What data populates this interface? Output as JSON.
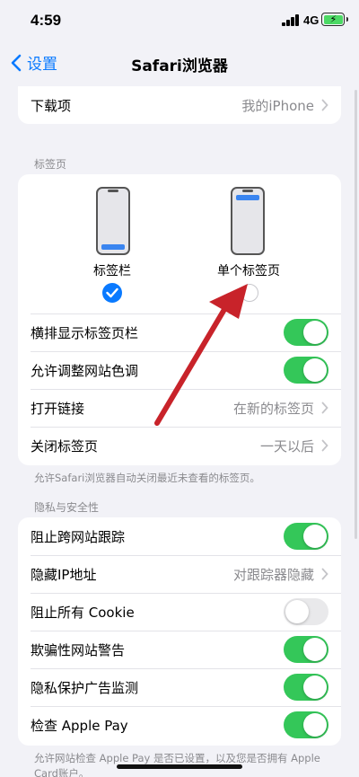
{
  "status_bar": {
    "time": "4:59",
    "network": "4G"
  },
  "nav": {
    "back_label": "设置",
    "title": "Safari浏览器"
  },
  "downloads": {
    "label": "下载项",
    "value": "我的iPhone"
  },
  "tabs_section": {
    "header": "标签页",
    "layout_options": [
      {
        "label": "标签栏",
        "selected": true
      },
      {
        "label": "单个标签页",
        "selected": false
      }
    ],
    "rows": [
      {
        "label": "横排显示标签页栏",
        "type": "toggle",
        "on": true
      },
      {
        "label": "允许调整网站色调",
        "type": "toggle",
        "on": true
      },
      {
        "label": "打开链接",
        "type": "value",
        "value": "在新的标签页"
      },
      {
        "label": "关闭标签页",
        "type": "value",
        "value": "一天以后"
      }
    ],
    "footer": "允许Safari浏览器自动关闭最近未查看的标签页。"
  },
  "privacy_section": {
    "header": "隐私与安全性",
    "rows": [
      {
        "label": "阻止跨网站跟踪",
        "type": "toggle",
        "on": true
      },
      {
        "label": "隐藏IP地址",
        "type": "value",
        "value": "对跟踪器隐藏"
      },
      {
        "label": "阻止所有 Cookie",
        "type": "toggle",
        "on": false
      },
      {
        "label": "欺骗性网站警告",
        "type": "toggle",
        "on": true
      },
      {
        "label": "隐私保护广告监测",
        "type": "toggle",
        "on": true
      },
      {
        "label": "检查 Apple Pay",
        "type": "toggle",
        "on": true
      }
    ],
    "footer": "允许网站检查 Apple Pay 是否已设置，以及您是否拥有 Apple Card账户。"
  },
  "colors": {
    "accent": "#0a7aff",
    "toggle_on": "#34c759",
    "annotation_arrow": "#c8232a"
  }
}
